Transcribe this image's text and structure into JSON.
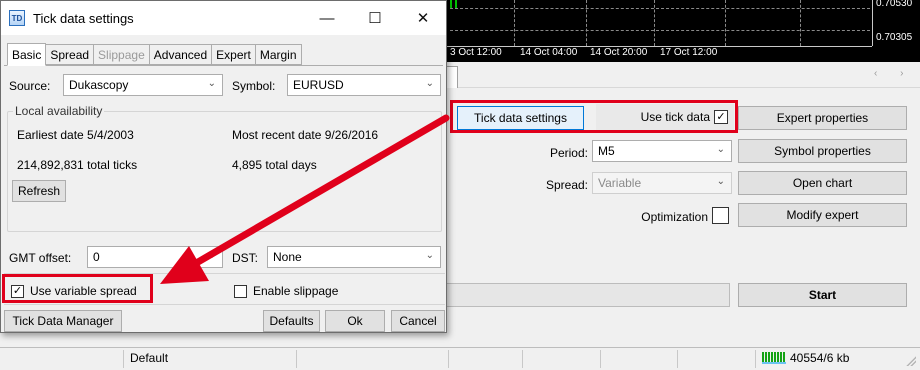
{
  "chart": {
    "prices": [
      "0.70530",
      "0.70305"
    ],
    "time_labels": [
      "3 Oct 12:00",
      "14 Oct 04:00",
      "14 Oct 20:00",
      "17 Oct 12:00"
    ]
  },
  "panel": {
    "tick_data_settings_btn": "Tick data settings",
    "use_tick_data_label": "Use tick data",
    "use_tick_data_checked": true,
    "expert_properties_btn": "Expert properties",
    "symbol_properties_btn": "Symbol properties",
    "open_chart_btn": "Open chart",
    "modify_expert_btn": "Modify expert",
    "period_label": "Period:",
    "period_value": "M5",
    "spread_label": "Spread:",
    "spread_value": "Variable",
    "optimization_label": "Optimization",
    "optimization_checked": false,
    "start_btn": "Start",
    "scroll_arrows": "‹ ›"
  },
  "status_bar": {
    "profile": "Default",
    "traffic": "40554/6 kb"
  },
  "dialog": {
    "title": "Tick data settings",
    "icon_text": "TD",
    "window_controls": {
      "minimize": "—",
      "maximize": "☐",
      "close": "✕"
    },
    "tabs": [
      {
        "label": "Basic",
        "active": true,
        "disabled": false
      },
      {
        "label": "Spread",
        "active": false,
        "disabled": false
      },
      {
        "label": "Slippage",
        "active": false,
        "disabled": true
      },
      {
        "label": "Advanced",
        "active": false,
        "disabled": false
      },
      {
        "label": "Expert",
        "active": false,
        "disabled": false
      },
      {
        "label": "Margin",
        "active": false,
        "disabled": false
      }
    ],
    "source_label": "Source:",
    "source_value": "Dukascopy",
    "symbol_label": "Symbol:",
    "symbol_value": "EURUSD",
    "local_availability": {
      "title": "Local availability",
      "earliest": "Earliest date 5/4/2003",
      "most_recent": "Most recent date 9/26/2016",
      "total_ticks": "214,892,831 total ticks",
      "total_days": "4,895 total days",
      "refresh_btn": "Refresh"
    },
    "gmt_offset_label": "GMT offset:",
    "gmt_offset_value": "0",
    "dst_label": "DST:",
    "dst_value": "None",
    "use_variable_spread_label": "Use variable spread",
    "use_variable_spread_checked": true,
    "enable_slippage_label": "Enable slippage",
    "enable_slippage_checked": false,
    "tick_data_manager_btn": "Tick Data Manager",
    "defaults_btn": "Defaults",
    "ok_btn": "Ok",
    "cancel_btn": "Cancel"
  },
  "colors": {
    "highlight": "#e0001b",
    "arrow": "#e0001b",
    "focus_border": "#0078d7",
    "connection_bars": "#14a214"
  },
  "chevron": "⌄",
  "check_mark": "✓"
}
